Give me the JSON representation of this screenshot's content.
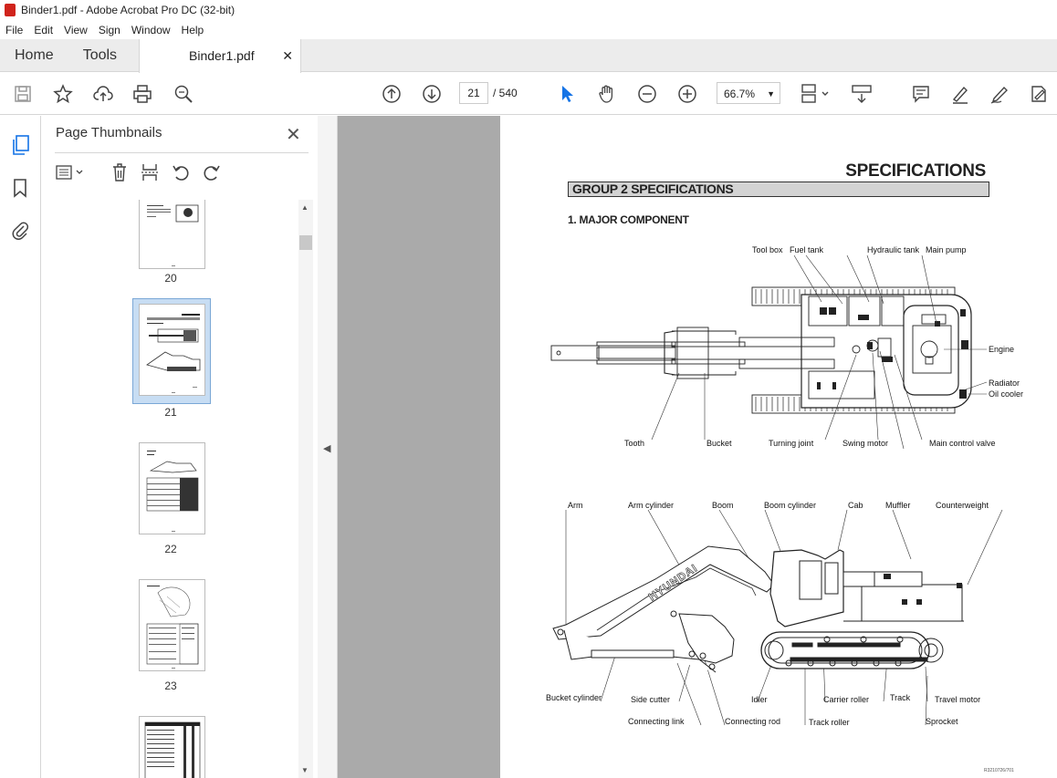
{
  "window": {
    "title": "Binder1.pdf - Adobe Acrobat Pro DC (32-bit)"
  },
  "menu": [
    "File",
    "Edit",
    "View",
    "Sign",
    "Window",
    "Help"
  ],
  "tabs": {
    "home": "Home",
    "tools": "Tools",
    "document": "Binder1.pdf"
  },
  "toolbar": {
    "current_page": "21",
    "total_pages": "/ 540",
    "zoom": "66.7%"
  },
  "panel": {
    "title": "Page Thumbnails"
  },
  "thumbnails": [
    {
      "label": "20"
    },
    {
      "label": "21",
      "selected": true
    },
    {
      "label": "22"
    },
    {
      "label": "23"
    },
    {
      "label": ""
    }
  ],
  "document": {
    "title": "SPECIFICATIONS",
    "group": "GROUP 2 SPECIFICATIONS",
    "section": "1. MAJOR COMPONENT",
    "code": "R3210726/701",
    "top_view_labels": {
      "tool_box": "Tool box",
      "fuel_tank": "Fuel tank",
      "hydraulic_tank": "Hydraulic tank",
      "main_pump": "Main pump",
      "engine": "Engine",
      "radiator": "Radiator",
      "oil_cooler": "Oil cooler",
      "tooth": "Tooth",
      "bucket": "Bucket",
      "turning_joint": "Turning joint",
      "swing_motor": "Swing motor",
      "main_control_valve": "Main control valve"
    },
    "side_view_labels": {
      "arm": "Arm",
      "arm_cylinder": "Arm cylinder",
      "boom": "Boom",
      "boom_cylinder": "Boom cylinder",
      "cab": "Cab",
      "muffler": "Muffler",
      "counterweight": "Counterweight",
      "brand": "HYUNDAI",
      "bucket_cylinder": "Bucket cylinder",
      "side_cutter": "Side cutter",
      "idler": "Idler",
      "carrier_roller": "Carrier roller",
      "track": "Track",
      "travel_motor": "Travel motor",
      "connecting_link": "Connecting link",
      "connecting_rod": "Connecting rod",
      "track_roller": "Track roller",
      "sprocket": "Sprocket"
    }
  }
}
